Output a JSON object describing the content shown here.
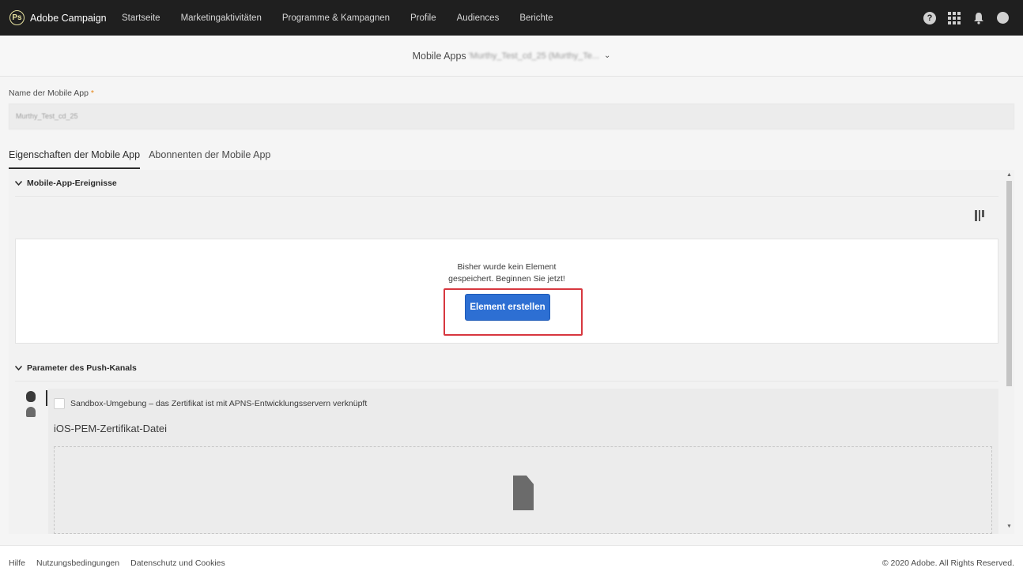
{
  "app": {
    "name": "Adobe Campaign",
    "logo_glyph": "Ps"
  },
  "nav": {
    "links": [
      "Startseite",
      "Marketingaktivitäten",
      "Programme & Kampagnen",
      "Profile",
      "Audiences",
      "Berichte"
    ],
    "help_glyph": "?"
  },
  "subheader": {
    "label": "Mobile Apps",
    "value": "'Murthy_Test_cd_25 (Murthy_Te...",
    "chevron": "⌄"
  },
  "form": {
    "name_label": "Name der Mobile App",
    "required_mark": "*",
    "name_value": "Murthy_Test_cd_25"
  },
  "tabs": [
    {
      "label": "Eigenschaften der Mobile App",
      "active": true
    },
    {
      "label": "Abonnenten der Mobile App",
      "active": false
    }
  ],
  "events_section": {
    "title": "Mobile-App-Ereignisse",
    "empty_line1": "Bisher wurde kein Element",
    "empty_line2": "gespeichert. Beginnen Sie jetzt!",
    "create_button": "Element erstellen"
  },
  "push_section": {
    "title": "Parameter des Push-Kanals",
    "sandbox_label": "Sandbox-Umgebung – das Zertifikat ist mit APNS-Entwicklungsservern verknüpft",
    "cert_title": "iOS-PEM-Zertifikat-Datei"
  },
  "footer": {
    "links": [
      "Hilfe",
      "Nutzungsbedingungen",
      "Datenschutz und Cookies"
    ],
    "copyright": "© 2020 Adobe. All Rights Reserved."
  },
  "colors": {
    "nav_bg": "#1f1f1f",
    "primary_button": "#2d6fd3",
    "highlight": "#d7373f",
    "required": "#e68619"
  }
}
